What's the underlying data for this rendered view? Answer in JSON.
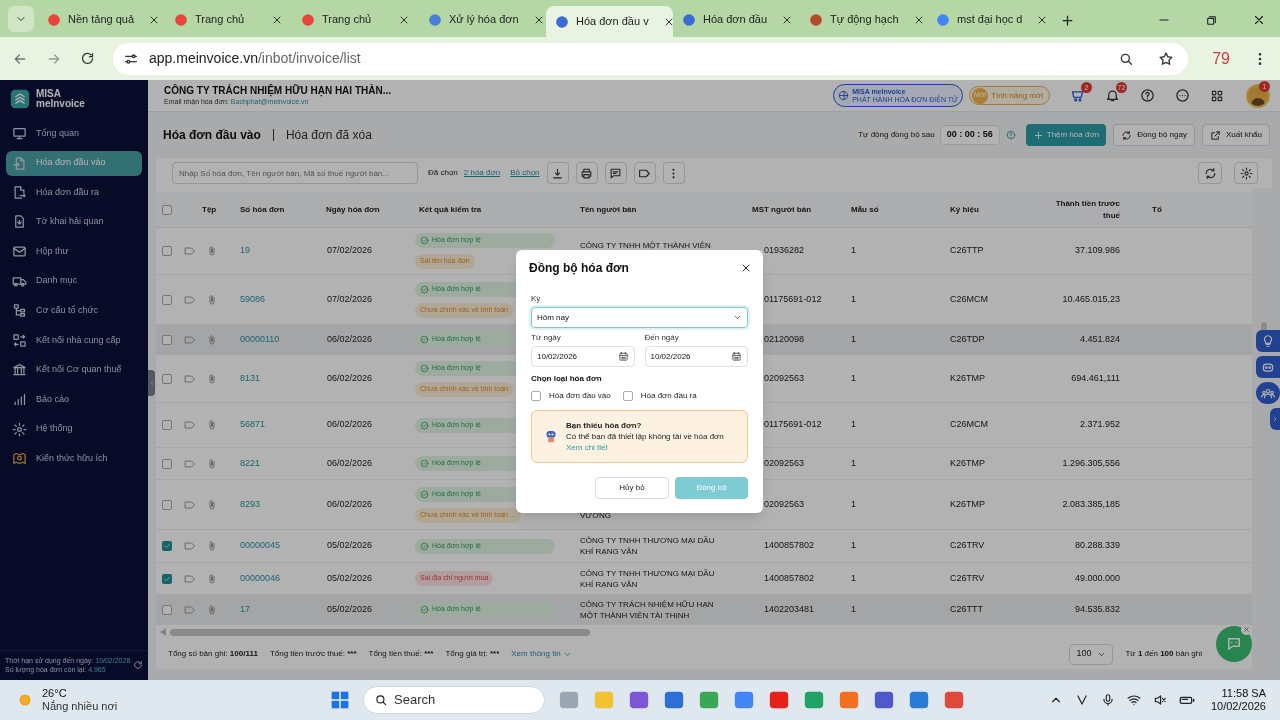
{
  "browser": {
    "tabs": [
      {
        "label": "Nền tảng quả",
        "selected": false
      },
      {
        "label": "Trang chủ",
        "selected": false
      },
      {
        "label": "Trang chủ",
        "selected": false
      },
      {
        "label": "Xử lý hóa đơn",
        "selected": false
      },
      {
        "label": "Hóa đơn đầu v",
        "selected": true
      },
      {
        "label": "Hóa đơn đầu",
        "selected": false
      },
      {
        "label": "Tự động hạch",
        "selected": false
      },
      {
        "label": "mst đại học d",
        "selected": false
      }
    ],
    "url_host": "app.meinvoice.vn",
    "url_path": "/inbot/invoice/list",
    "extension_badge": "79"
  },
  "sidebar": {
    "logo_line1": "MISA",
    "logo_line2": "meInvoice",
    "items": [
      {
        "label": "Tổng quan",
        "selected": false
      },
      {
        "label": "Hóa đơn đầu vào",
        "selected": true
      },
      {
        "label": "Hóa đơn đầu ra",
        "selected": false
      },
      {
        "label": "Tờ khai hải quan",
        "selected": false
      },
      {
        "label": "Hộp thư",
        "selected": false
      },
      {
        "label": "Danh mục",
        "selected": false
      },
      {
        "label": "Cơ cấu tổ chức",
        "selected": false
      },
      {
        "label": "Kết nối nhà cung cấp",
        "selected": false
      },
      {
        "label": "Kết nối Cơ quan thuế",
        "selected": false
      },
      {
        "label": "Báo cáo",
        "selected": false
      },
      {
        "label": "Hệ thống",
        "selected": false
      },
      {
        "label": "Kiến thức hữu ích",
        "selected": false
      }
    ],
    "footer": [
      {
        "label": "Thời hạn sử dụng đến ngày:",
        "value": "10/02/2028"
      },
      {
        "label": "Số lượng hóa đơn còn lại:",
        "value": "4.965"
      }
    ]
  },
  "header": {
    "company": "CÔNG TY TRÁCH NHIỆM HỮU HẠN HAI THÀN...",
    "email_label": "Email nhận hóa đơn:",
    "email": "Bachphat@meinvoice.vn",
    "brand": "MISA meInvoice",
    "brand_sub": "PHÁT HÀNH HÓA ĐƠN ĐIỆN TỬ",
    "new_badge": "Mới",
    "new_features": "Tính năng mới",
    "cart_count": "2",
    "bell_count": "72",
    "avatar_count": "1"
  },
  "page_tabs": [
    {
      "label": "Hóa đơn đầu vào",
      "selected": true
    },
    {
      "label": "Hóa đơn đã xóa",
      "selected": false
    }
  ],
  "sync": {
    "label": "Tự động đồng bộ sau",
    "timer": "00 : 00 : 56"
  },
  "actions": [
    {
      "label": "Thêm hóa đơn",
      "kind": "primary"
    },
    {
      "label": "Đồng bộ ngay",
      "kind": "sync"
    },
    {
      "label": "Xuất khẩu",
      "kind": "export"
    }
  ],
  "toolbar": {
    "search_placeholder": "Nhập Số hóa đơn, Tên người bán, Mã số thuế người bán...",
    "selected_label": "Đã chọn",
    "selected_link": "2 hóa đơn",
    "clear_link": "Bỏ chọn"
  },
  "table": {
    "select_all_checked": false,
    "columns": [
      "Tệp",
      "Số hóa đơn",
      "Ngày hóa đơn",
      "Kết quả kiểm tra",
      "Tên người bán",
      "MST người bán",
      "Mẫu số",
      "Ký hiệu",
      "Thành tiền trước thuế",
      "Tổ"
    ],
    "rows": [
      {
        "checked": false,
        "highlighted": false,
        "number": "19",
        "date": "07/02/2026",
        "results": [
          {
            "kind": "ok",
            "text": "Hóa đơn hợp lệ"
          },
          {
            "kind": "warn",
            "text": "Sai tên hóa đơn"
          }
        ],
        "seller": "CÔNG TY TNHH MỘT THÀNH VIÊN",
        "mst": "01936282",
        "form": "1",
        "symbol": "C26TTP",
        "amount": "37.109.986"
      },
      {
        "checked": false,
        "highlighted": false,
        "number": "59086",
        "date": "07/02/2026",
        "results": [
          {
            "kind": "ok",
            "text": "Hóa đơn hợp lệ"
          },
          {
            "kind": "warn",
            "text": "Chưa chính xác về tính toán"
          }
        ],
        "mst": "01175691-012",
        "form": "1",
        "symbol": "C26MCM",
        "amount": "10.465.015,23"
      },
      {
        "checked": false,
        "highlighted": true,
        "number": "00000110",
        "date": "06/02/2026",
        "results": [
          {
            "kind": "ok",
            "text": "Hóa đơn hợp lệ"
          }
        ],
        "mst": "02120098",
        "form": "1",
        "symbol": "C26TDP",
        "amount": "4.451.824"
      },
      {
        "checked": false,
        "highlighted": false,
        "number": "8131",
        "date": "06/02/2026",
        "results": [
          {
            "kind": "ok",
            "text": "Hóa đơn hợp lệ"
          },
          {
            "kind": "warn",
            "text": "Chưa chính xác về tính toán"
          }
        ],
        "mst": "02092563",
        "form": "1",
        "symbol": "K26TMP",
        "amount": "694.461,111"
      },
      {
        "checked": false,
        "highlighted": false,
        "number": "56871",
        "date": "06/02/2026",
        "results": [
          {
            "kind": "ok",
            "text": "Hóa đơn hợp lệ"
          }
        ],
        "mst": "01175691-012",
        "form": "1",
        "symbol": "C26MCM",
        "amount": "2.371.952"
      },
      {
        "checked": false,
        "highlighted": false,
        "number": "8221",
        "date": "06/02/2026",
        "results": [
          {
            "kind": "ok",
            "text": "Hóa đơn hợp lệ"
          }
        ],
        "mst": "02092563",
        "form": "1",
        "symbol": "K26TMP",
        "amount": "1.296.305,556"
      },
      {
        "checked": false,
        "highlighted": false,
        "number": "8293",
        "date": "06/02/2026",
        "results": [
          {
            "kind": "ok",
            "text": "Hóa đơn hợp lệ"
          },
          {
            "kind": "warn",
            "text": "Chưa chính xác về tính toán ..."
          }
        ],
        "seller": "VƯƠNG",
        "mst": "02092563",
        "form": "1",
        "symbol": "K26TMP",
        "amount": "2.083.385,185"
      },
      {
        "checked": true,
        "highlighted": false,
        "number": "00000045",
        "date": "05/02/2026",
        "results": [
          {
            "kind": "ok",
            "text": "Hóa đơn hợp lệ"
          }
        ],
        "seller": "CÔNG TY TNHH THƯƠNG MẠI DẦU KHÍ RẠNG VÂN",
        "mst": "1400857802",
        "form": "1",
        "symbol": "C26TRV",
        "amount": "80.288.339"
      },
      {
        "checked": true,
        "highlighted": false,
        "number": "00000046",
        "date": "05/02/2026",
        "results": [
          {
            "kind": "error",
            "text": "Sai địa chỉ người mua"
          }
        ],
        "seller": "CÔNG TY TNHH THƯƠNG MẠI DẦU KHÍ RẠNG VÂN",
        "mst": "1400857802",
        "form": "1",
        "symbol": "C26TRV",
        "amount": "49.000.000"
      },
      {
        "checked": false,
        "highlighted": true,
        "number": "17",
        "date": "05/02/2026",
        "results": [
          {
            "kind": "ok",
            "text": "Hóa đơn hợp lệ"
          }
        ],
        "seller": "CÔNG TY TRÁCH NHIỆM HỮU HẠN MỘT THÀNH VIÊN TÀI THỊNH",
        "mst": "1402203481",
        "form": "1",
        "symbol": "C26TTT",
        "amount": "94.535.832"
      }
    ]
  },
  "footer": {
    "stats": [
      {
        "label": "Tổng số bản ghi:",
        "value": "100/111"
      },
      {
        "label": "Tổng tiền trước thuế:",
        "value": "***"
      },
      {
        "label": "Tổng tiền thuế:",
        "value": "***"
      },
      {
        "label": "Tổng giá trị:",
        "value": "***"
      }
    ],
    "details_link": "Xem thông tin",
    "page_size": "100",
    "range": "Từ **1** đến **100** bản ghi"
  },
  "dialog": {
    "title": "Đồng bộ hóa đơn",
    "period_label": "Kỳ",
    "period": "Hôm nay",
    "from_label": "Từ ngày",
    "from": "10/02/2026",
    "to_label": "Đến ngày",
    "to": "10/02/2026",
    "type_label": "Chọn loại hóa đơn",
    "types": [
      {
        "label": "Hóa đơn đầu vào",
        "checked": false
      },
      {
        "label": "Hóa đơn đầu ra",
        "checked": false
      }
    ],
    "notice_title": "Bạn thiếu hóa đơn?",
    "notice_text": "Có thể bạn đã thiết lập không tải về hóa đơn",
    "notice_link": "Xem chi tiết",
    "cancel": "Hủy bỏ",
    "confirm": "Đồng bộ",
    "confirm_disabled": true
  },
  "taskbar": {
    "temp": "26°C",
    "weather": "Nắng nhiều nơi",
    "search": "Search",
    "time": "11:58 SA",
    "date": "10/02/2026"
  }
}
